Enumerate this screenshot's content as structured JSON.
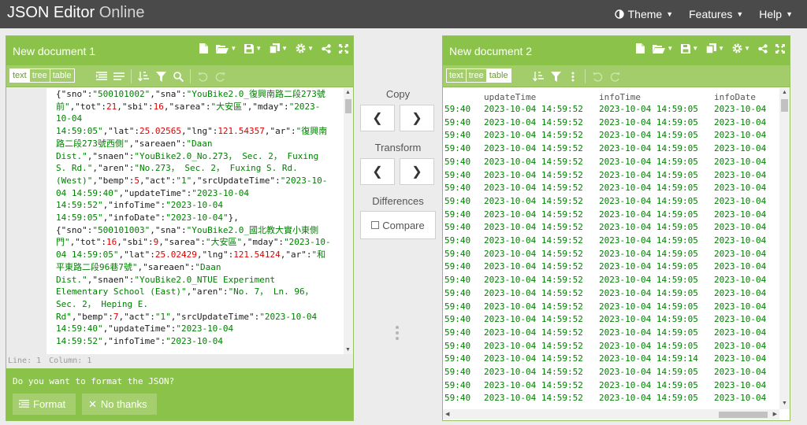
{
  "app": {
    "brand_main": "JSON Editor",
    "brand_light": " Online"
  },
  "nav": {
    "theme": "Theme",
    "features": "Features",
    "help": "Help"
  },
  "left": {
    "title": "New document 1",
    "modes": [
      "text",
      "tree",
      "table"
    ],
    "active_mode": "text",
    "status_line": "Line: 1",
    "status_column": "Column: 1",
    "format_prompt": "Do you want to format the JSON?",
    "format_button": "Format",
    "nothanks_button": "No thanks",
    "code_lines": [
      [
        [
          "k",
          "{\"sno\":"
        ],
        [
          "s",
          "\"500101002\""
        ],
        [
          "k",
          ",\"sna\":"
        ],
        [
          "s",
          "\"YouBike2.0_復興南路二段273號"
        ]
      ],
      [
        [
          "s",
          "前\""
        ],
        [
          "k",
          ",\"tot\":"
        ],
        [
          "n",
          "21"
        ],
        [
          "k",
          ",\"sbi\":"
        ],
        [
          "n",
          "16"
        ],
        [
          "k",
          ",\"sarea\":"
        ],
        [
          "s",
          "\"大安區\""
        ],
        [
          "k",
          ",\"mday\":"
        ],
        [
          "s",
          "\"2023-"
        ]
      ],
      [
        [
          "s",
          "10-04"
        ]
      ],
      [
        [
          "s",
          "14:59:05\""
        ],
        [
          "k",
          ",\"lat\":"
        ],
        [
          "n",
          "25.02565"
        ],
        [
          "k",
          ",\"lng\":"
        ],
        [
          "n",
          "121.54357"
        ],
        [
          "k",
          ",\"ar\":"
        ],
        [
          "s",
          "\"復興南"
        ]
      ],
      [
        [
          "s",
          "路二段273號西側\""
        ],
        [
          "k",
          ",\"sareaen\":"
        ],
        [
          "s",
          "\"Daan"
        ]
      ],
      [
        [
          "s",
          "Dist.\""
        ],
        [
          "k",
          ",\"snaen\":"
        ],
        [
          "s",
          "\"YouBike2.0_No.273， Sec. 2， Fuxing"
        ]
      ],
      [
        [
          "s",
          "S. Rd.\""
        ],
        [
          "k",
          ",\"aren\":"
        ],
        [
          "s",
          "\"No.273， Sec. 2， Fuxing S. Rd."
        ]
      ],
      [
        [
          "s",
          "(West)\""
        ],
        [
          "k",
          ",\"bemp\":"
        ],
        [
          "n",
          "5"
        ],
        [
          "k",
          ",\"act\":"
        ],
        [
          "s",
          "\"1\""
        ],
        [
          "k",
          ",\"srcUpdateTime\":"
        ],
        [
          "s",
          "\"2023-10-"
        ]
      ],
      [
        [
          "s",
          "04 14:59:40\""
        ],
        [
          "k",
          ",\"updateTime\":"
        ],
        [
          "s",
          "\"2023-10-04"
        ]
      ],
      [
        [
          "s",
          "14:59:52\""
        ],
        [
          "k",
          ",\"infoTime\":"
        ],
        [
          "s",
          "\"2023-10-04"
        ]
      ],
      [
        [
          "s",
          "14:59:05\""
        ],
        [
          "k",
          ",\"infoDate\":"
        ],
        [
          "s",
          "\"2023-10-04\""
        ],
        [
          "k",
          "},"
        ]
      ],
      [
        [
          "k",
          "{\"sno\":"
        ],
        [
          "s",
          "\"500101003\""
        ],
        [
          "k",
          ",\"sna\":"
        ],
        [
          "s",
          "\"YouBike2.0_國北教大實小東側"
        ]
      ],
      [
        [
          "s",
          "門\""
        ],
        [
          "k",
          ",\"tot\":"
        ],
        [
          "n",
          "16"
        ],
        [
          "k",
          ",\"sbi\":"
        ],
        [
          "n",
          "9"
        ],
        [
          "k",
          ",\"sarea\":"
        ],
        [
          "s",
          "\"大安區\""
        ],
        [
          "k",
          ",\"mday\":"
        ],
        [
          "s",
          "\"2023-10-"
        ]
      ],
      [
        [
          "s",
          "04 14:59:05\""
        ],
        [
          "k",
          ",\"lat\":"
        ],
        [
          "n",
          "25.02429"
        ],
        [
          "k",
          ",\"lng\":"
        ],
        [
          "n",
          "121.54124"
        ],
        [
          "k",
          ",\"ar\":"
        ],
        [
          "s",
          "\"和"
        ]
      ],
      [
        [
          "s",
          "平東路二段96巷7號\""
        ],
        [
          "k",
          ",\"sareaen\":"
        ],
        [
          "s",
          "\"Daan"
        ]
      ],
      [
        [
          "s",
          "Dist.\""
        ],
        [
          "k",
          ",\"snaen\":"
        ],
        [
          "s",
          "\"YouBike2.0_NTUE Experiment"
        ]
      ],
      [
        [
          "s",
          "Elementary School (East)\""
        ],
        [
          "k",
          ",\"aren\":"
        ],
        [
          "s",
          "\"No. 7， Ln. 96，"
        ]
      ],
      [
        [
          "s",
          "Sec. 2， Heping E."
        ]
      ],
      [
        [
          "s",
          "Rd\""
        ],
        [
          "k",
          ",\"bemp\":"
        ],
        [
          "n",
          "7"
        ],
        [
          "k",
          ",\"act\":"
        ],
        [
          "s",
          "\"1\""
        ],
        [
          "k",
          ",\"srcUpdateTime\":"
        ],
        [
          "s",
          "\"2023-10-04"
        ]
      ],
      [
        [
          "s",
          "14:59:40\""
        ],
        [
          "k",
          ",\"updateTime\":"
        ],
        [
          "s",
          "\"2023-10-04"
        ]
      ],
      [
        [
          "s",
          "14:59:52\""
        ],
        [
          "k",
          ",\"infoTime\":"
        ],
        [
          "s",
          "\"2023-10-04"
        ]
      ]
    ]
  },
  "middle": {
    "copy": "Copy",
    "transform": "Transform",
    "differences": "Differences",
    "compare": "Compare"
  },
  "right": {
    "title": "New document 2",
    "modes": [
      "text",
      "tree",
      "table"
    ],
    "active_mode": "table",
    "columns": [
      "updateTime",
      "infoTime",
      "infoDate"
    ],
    "rows": [
      [
        "59:40",
        "2023-10-04 14:59:52",
        "2023-10-04 14:59:05",
        "2023-10-04"
      ],
      [
        "59:40",
        "2023-10-04 14:59:52",
        "2023-10-04 14:59:05",
        "2023-10-04"
      ],
      [
        "59:40",
        "2023-10-04 14:59:52",
        "2023-10-04 14:59:05",
        "2023-10-04"
      ],
      [
        "59:40",
        "2023-10-04 14:59:52",
        "2023-10-04 14:59:05",
        "2023-10-04"
      ],
      [
        "59:40",
        "2023-10-04 14:59:52",
        "2023-10-04 14:59:05",
        "2023-10-04"
      ],
      [
        "59:40",
        "2023-10-04 14:59:52",
        "2023-10-04 14:59:05",
        "2023-10-04"
      ],
      [
        "59:40",
        "2023-10-04 14:59:52",
        "2023-10-04 14:59:05",
        "2023-10-04"
      ],
      [
        "59:40",
        "2023-10-04 14:59:52",
        "2023-10-04 14:59:05",
        "2023-10-04"
      ],
      [
        "59:40",
        "2023-10-04 14:59:52",
        "2023-10-04 14:59:05",
        "2023-10-04"
      ],
      [
        "59:40",
        "2023-10-04 14:59:52",
        "2023-10-04 14:59:05",
        "2023-10-04"
      ],
      [
        "59:40",
        "2023-10-04 14:59:52",
        "2023-10-04 14:59:05",
        "2023-10-04"
      ],
      [
        "59:40",
        "2023-10-04 14:59:52",
        "2023-10-04 14:59:05",
        "2023-10-04"
      ],
      [
        "59:40",
        "2023-10-04 14:59:52",
        "2023-10-04 14:59:05",
        "2023-10-04"
      ],
      [
        "59:40",
        "2023-10-04 14:59:52",
        "2023-10-04 14:59:05",
        "2023-10-04"
      ],
      [
        "59:40",
        "2023-10-04 14:59:52",
        "2023-10-04 14:59:05",
        "2023-10-04"
      ],
      [
        "59:40",
        "2023-10-04 14:59:52",
        "2023-10-04 14:59:05",
        "2023-10-04"
      ],
      [
        "59:40",
        "2023-10-04 14:59:52",
        "2023-10-04 14:59:05",
        "2023-10-04"
      ],
      [
        "59:40",
        "2023-10-04 14:59:52",
        "2023-10-04 14:59:05",
        "2023-10-04"
      ],
      [
        "59:40",
        "2023-10-04 14:59:52",
        "2023-10-04 14:59:05",
        "2023-10-04"
      ],
      [
        "59:40",
        "2023-10-04 14:59:52",
        "2023-10-04 14:59:14",
        "2023-10-04"
      ],
      [
        "59:40",
        "2023-10-04 14:59:52",
        "2023-10-04 14:59:05",
        "2023-10-04"
      ],
      [
        "59:40",
        "2023-10-04 14:59:52",
        "2023-10-04 14:59:05",
        "2023-10-04"
      ],
      [
        "59:40",
        "2023-10-04 14:59:52",
        "2023-10-04 14:59:05",
        "2023-10-04"
      ]
    ]
  },
  "colors": {
    "accent": "#8bc34a",
    "topbar": "#4a4a4a",
    "string": "#008000",
    "number": "#e00000"
  }
}
